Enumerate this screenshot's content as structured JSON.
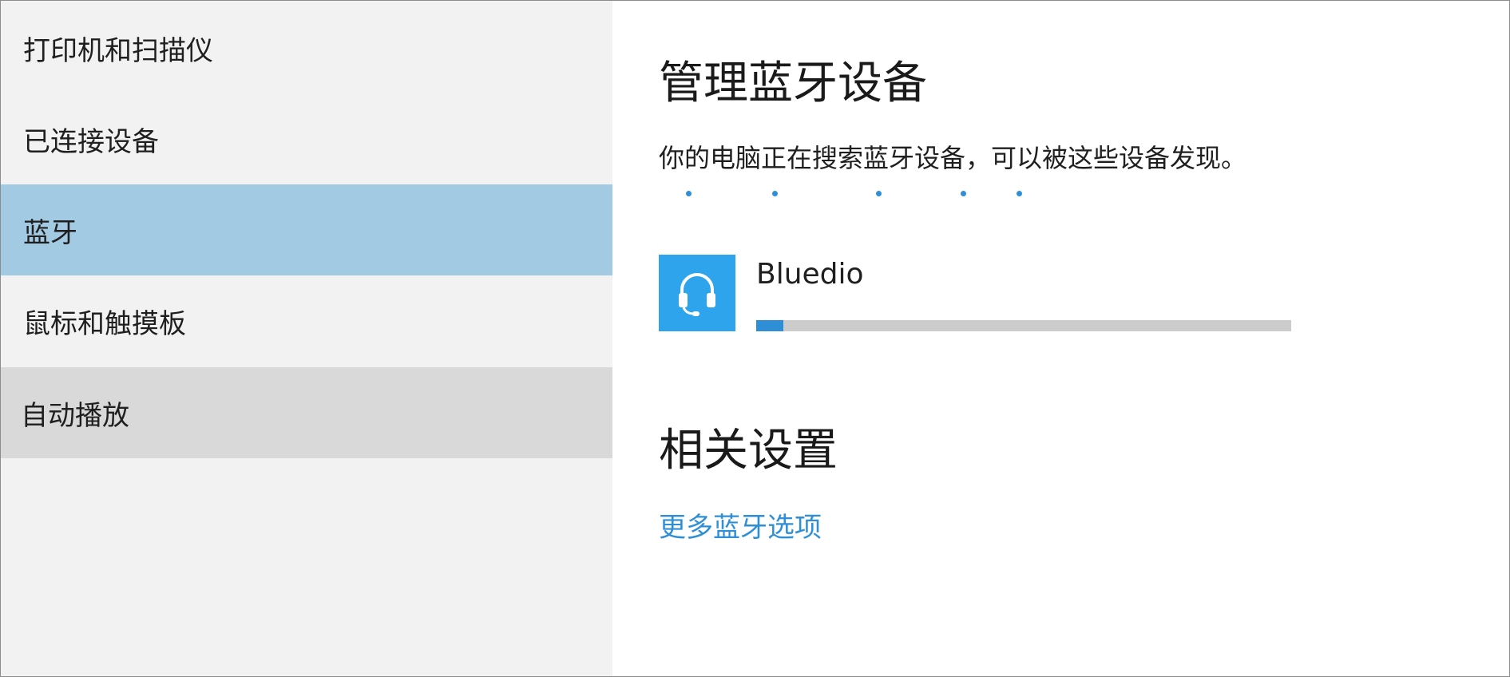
{
  "sidebar": {
    "items": [
      {
        "label": "打印机和扫描仪"
      },
      {
        "label": "已连接设备"
      },
      {
        "label": "蓝牙"
      },
      {
        "label": "鼠标和触摸板"
      },
      {
        "label": "自动播放"
      }
    ],
    "selected": "蓝牙",
    "hovered": "自动播放"
  },
  "main": {
    "title": "管理蓝牙设备",
    "description": "你的电脑正在搜索蓝牙设备，可以被这些设备发现。",
    "searching_indicator": "dots",
    "devices": [
      {
        "name": "Bluedio",
        "icon": "headset-icon",
        "progress": 0.05
      }
    ],
    "related": {
      "title": "相关设置",
      "link": "更多蓝牙选项"
    }
  },
  "colors": {
    "accent": "#2f8fd6",
    "selected_bg": "#a2cae3",
    "hover_bg": "#d9d9d9",
    "sidebar_bg": "#f2f2f2",
    "device_tile": "#2ea4ec"
  }
}
